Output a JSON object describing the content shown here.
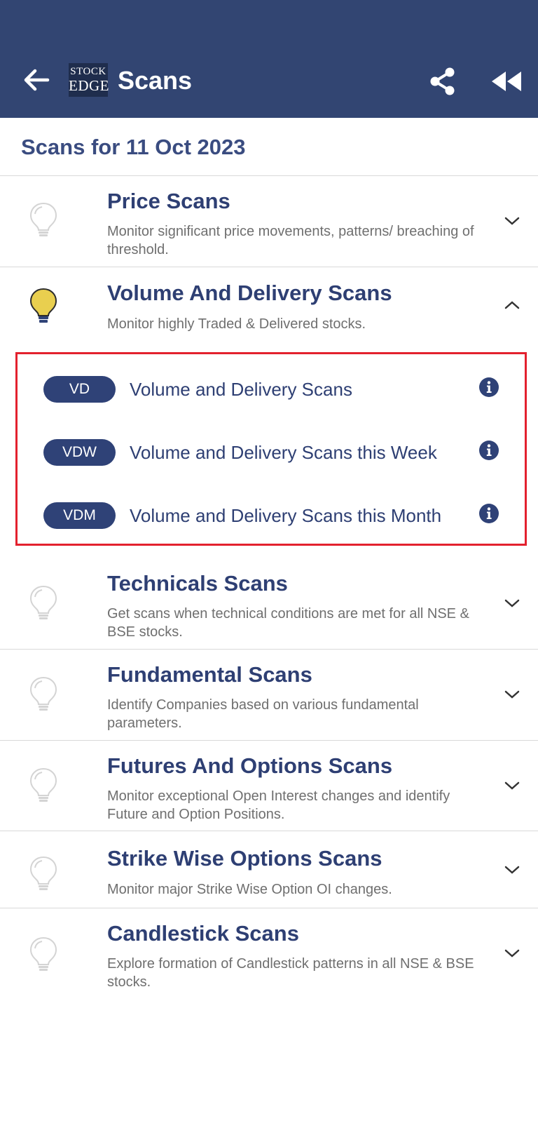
{
  "header": {
    "title": "Scans",
    "logo_line1": "STOCK",
    "logo_line2": "EDGE",
    "back_icon": "arrow-left-icon",
    "share_icon": "share-icon",
    "rewind_icon": "fast-rewind-icon"
  },
  "date_heading": "Scans for 11 Oct 2023",
  "sections": [
    {
      "title": "Price Scans",
      "desc": "Monitor significant price movements, patterns/ breaching of threshold.",
      "expanded": false
    },
    {
      "title": "Volume And Delivery Scans",
      "desc": "Monitor highly Traded & Delivered stocks.",
      "expanded": true
    },
    {
      "title": "Technicals Scans",
      "desc": "Get scans when technical conditions are met for all NSE & BSE stocks.",
      "expanded": false
    },
    {
      "title": "Fundamental Scans",
      "desc": "Identify Companies based on various fundamental parameters.",
      "expanded": false
    },
    {
      "title": "Futures And Options Scans",
      "desc": "Monitor exceptional Open Interest changes and identify Future and Option Positions.",
      "expanded": false
    },
    {
      "title": "Strike Wise Options Scans",
      "desc": "Monitor major Strike Wise Option OI changes.",
      "expanded": false
    },
    {
      "title": "Candlestick Scans",
      "desc": "Explore formation of Candlestick patterns in all NSE & BSE stocks.",
      "expanded": false
    }
  ],
  "volume_scans": [
    {
      "badge": "VD",
      "label": "Volume and Delivery Scans"
    },
    {
      "badge": "VDW",
      "label": "Volume and Delivery Scans this Week"
    },
    {
      "badge": "VDM",
      "label": "Volume and Delivery Scans this Month"
    }
  ],
  "colors": {
    "appbar": "#324572",
    "accent": "#2f4277",
    "bulb_active": "#e9cf4f",
    "highlight_border": "#e3212e"
  }
}
